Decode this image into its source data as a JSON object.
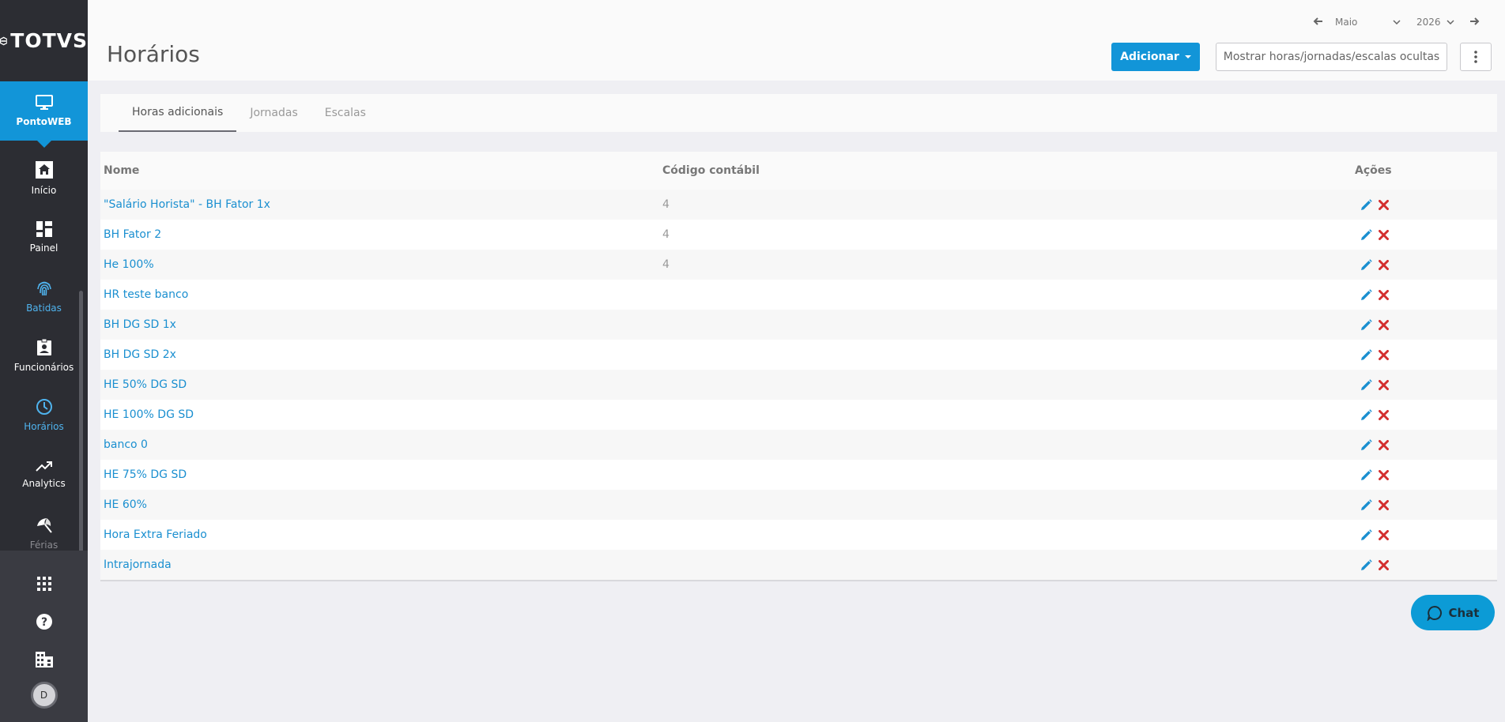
{
  "brand": {
    "name": "TOTVS"
  },
  "sidebar": {
    "active_module": {
      "label": "PontoWEB",
      "icon": "monitor-icon"
    },
    "items": [
      {
        "label": "Início",
        "icon": "home-icon"
      },
      {
        "label": "Painel",
        "icon": "dashboard-icon"
      },
      {
        "label": "Batidas",
        "icon": "fingerprint-icon"
      },
      {
        "label": "Funcionários",
        "icon": "badge-icon"
      },
      {
        "label": "Horários",
        "icon": "clock-icon"
      },
      {
        "label": "Analytics",
        "icon": "trending-up-icon"
      },
      {
        "label": "Férias",
        "icon": "beach-umbrella-icon"
      }
    ],
    "bottom": {
      "avatar_initial": "D"
    }
  },
  "header": {
    "title": "Horários",
    "period": {
      "month": "Maio",
      "year": "2026"
    },
    "add_label": "Adicionar",
    "hidden_label": "Mostrar horas/jornadas/escalas ocultas"
  },
  "tabs": [
    {
      "label": "Horas adicionais",
      "active": true
    },
    {
      "label": "Jornadas",
      "active": false
    },
    {
      "label": "Escalas",
      "active": false
    }
  ],
  "table": {
    "headers": {
      "name": "Nome",
      "code": "Código contábil",
      "actions": "Ações"
    },
    "rows": [
      {
        "name": "\"Salário Horista\" - BH Fator 1x",
        "code": "4"
      },
      {
        "name": "BH Fator 2",
        "code": "4"
      },
      {
        "name": "He 100%",
        "code": "4"
      },
      {
        "name": "HR teste banco",
        "code": ""
      },
      {
        "name": "BH DG SD 1x",
        "code": ""
      },
      {
        "name": "BH DG SD 2x",
        "code": ""
      },
      {
        "name": "HE 50% DG SD",
        "code": ""
      },
      {
        "name": "HE 100% DG SD",
        "code": ""
      },
      {
        "name": "banco 0",
        "code": ""
      },
      {
        "name": "HE 75% DG SD",
        "code": ""
      },
      {
        "name": "HE 60%",
        "code": ""
      },
      {
        "name": "Hora Extra Feriado",
        "code": ""
      },
      {
        "name": "Intrajornada",
        "code": ""
      }
    ]
  },
  "chat": {
    "label": "Chat"
  },
  "colors": {
    "accent": "#1295d8",
    "sidebar": "#2c2d33",
    "link": "#1a8fd0",
    "delete": "#d32f2f"
  }
}
